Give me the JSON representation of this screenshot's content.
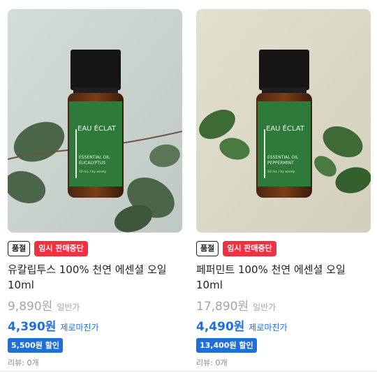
{
  "products": [
    {
      "brand": "EAU ÉCLAT",
      "label_line1": "ESSENTIAL OIL",
      "label_line2": "EUCALYPTUS",
      "label_size": "10 mL / by wisely",
      "badge_soldout": "품절",
      "badge_status": "임시 판매중단",
      "title": "유칼립투스 100% 천연 에센셜 오일 10ml",
      "original_price": "9,890원",
      "original_label": "일반가",
      "sale_price": "4,390원",
      "sale_label": "제로마진가",
      "discount": "5,500원 할인",
      "review": "리뷰: 0개",
      "bg_color": "#c9d2cd"
    },
    {
      "brand": "EAU ÉCLAT",
      "label_line1": "ESSENTIAL OIL",
      "label_line2": "PEPPERMINT",
      "label_size": "10 mL / by wisely",
      "badge_soldout": "품절",
      "badge_status": "임시 판매중단",
      "title": "페퍼민트 100% 천연 에센셜 오일 10ml",
      "original_price": "17,890원",
      "original_label": "일반가",
      "sale_price": "4,490원",
      "sale_label": "제로마진가",
      "discount": "13,400원 할인",
      "review": "리뷰: 0개",
      "bg_color": "#ddd9c8"
    }
  ],
  "colors": {
    "accent_blue": "#1f6fd8",
    "stop_red": "#f0313f",
    "label_green": "#2d7a3a"
  }
}
